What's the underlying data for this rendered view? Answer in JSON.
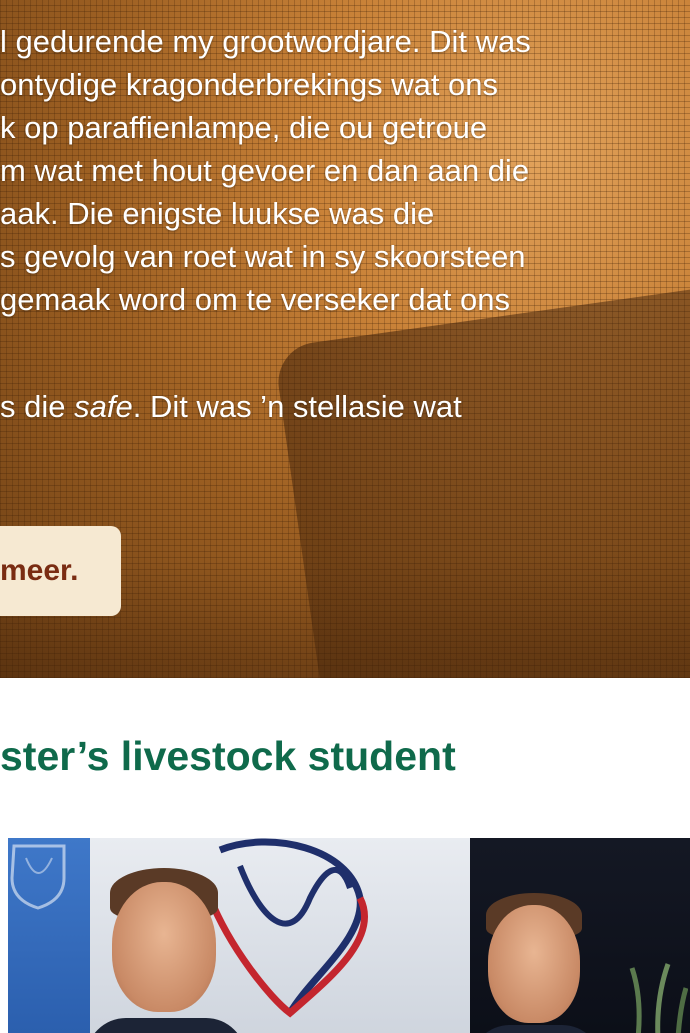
{
  "article": {
    "lines": [
      "l gedurende my grootwordjare. Dit was",
      "ontydige kragonderbrekings wat ons",
      "k op paraffienlampe, die ou getroue",
      "m wat met hout gevoer en dan aan die",
      "aak. Die enigste luukse was die",
      "s gevolg van roet wat in sy skoorsteen",
      "gemaak word om te verseker dat ons"
    ],
    "line8_prefix": "s die ",
    "line8_em": "safe",
    "line8_suffix": ". Dit was ’n stellasie wat"
  },
  "read_more": {
    "label": "meer."
  },
  "section": {
    "title": "ster’s livestock student"
  },
  "colors": {
    "title": "#0f6a4b",
    "read_more_bg": "#f6e9d2",
    "read_more_text": "#7a2c12",
    "logo_navy": "#1f2f6b",
    "logo_red": "#c4262e"
  }
}
